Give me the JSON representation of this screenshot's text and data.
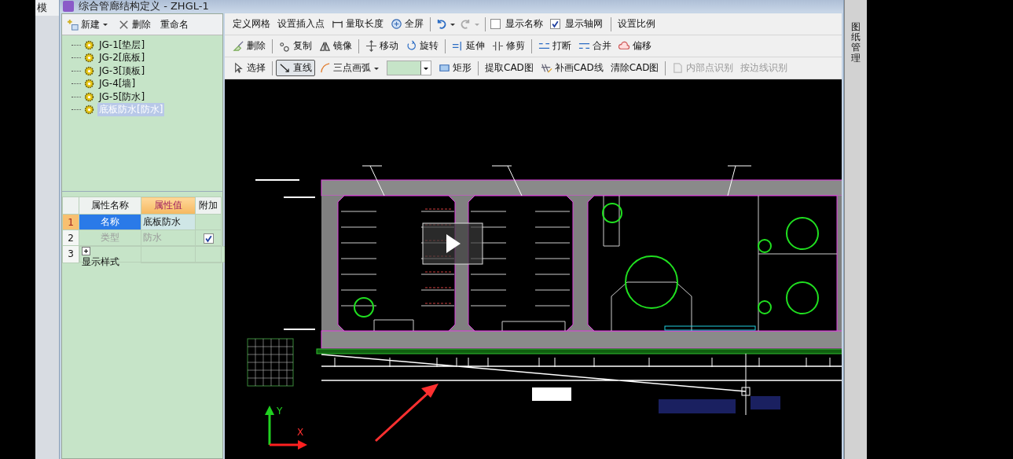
{
  "background_app": {
    "label": "模"
  },
  "window": {
    "title": "综合管廊结构定义 - ZHGL-1"
  },
  "tree_toolbar": [
    {
      "label": "新建",
      "dropdown": true
    },
    {
      "label": "删除",
      "dropdown": false
    },
    {
      "label": "重命名",
      "dropdown": false
    }
  ],
  "tree": {
    "items": [
      {
        "label": "JG-1[垫层]",
        "selected": false
      },
      {
        "label": "JG-2[底板]",
        "selected": false
      },
      {
        "label": "JG-3[顶板]",
        "selected": false
      },
      {
        "label": "JG-4[墙]",
        "selected": false
      },
      {
        "label": "JG-5[防水]",
        "selected": false
      },
      {
        "label": "底板防水[防水]",
        "selected": true
      }
    ]
  },
  "properties": {
    "columns": [
      {
        "label": "属性名称",
        "selected": false
      },
      {
        "label": "属性值",
        "selected": true
      },
      {
        "label": "附加",
        "selected": false
      }
    ],
    "rows": [
      {
        "number": "1",
        "name": "名称",
        "value": "底板防水",
        "selected": true,
        "disabled": false
      },
      {
        "number": "2",
        "name": "类型",
        "value": "防水",
        "selected": false,
        "disabled": true,
        "extra_checked": true
      },
      {
        "number": "3",
        "name": "显示样式",
        "selected": false,
        "disabled": false,
        "expanded": false
      }
    ]
  },
  "toolbar_rows": [
    [
      {
        "kind": "button",
        "label": "定义网格"
      },
      {
        "kind": "button",
        "label": "设置插入点"
      },
      {
        "kind": "button",
        "label": "量取长度"
      },
      {
        "kind": "button",
        "label": "全屏"
      },
      {
        "kind": "separator"
      },
      {
        "kind": "icon-button",
        "dropdown": true,
        "disabled": false
      },
      {
        "kind": "icon-button",
        "dropdown": true,
        "disabled": true
      },
      {
        "kind": "separator"
      },
      {
        "kind": "checkbox",
        "label": "显示名称",
        "checked": false
      },
      {
        "kind": "checkbox",
        "label": "显示轴网",
        "checked": true
      },
      {
        "kind": "separator"
      },
      {
        "kind": "button",
        "label": "设置比例"
      }
    ],
    [
      {
        "kind": "button",
        "label": "删除"
      },
      {
        "kind": "separator"
      },
      {
        "kind": "button",
        "label": "复制"
      },
      {
        "kind": "button",
        "label": "镜像"
      },
      {
        "kind": "separator"
      },
      {
        "kind": "button",
        "label": "移动"
      },
      {
        "kind": "button",
        "label": "旋转"
      },
      {
        "kind": "separator"
      },
      {
        "kind": "button",
        "label": "延伸"
      },
      {
        "kind": "button",
        "label": "修剪"
      },
      {
        "kind": "separator"
      },
      {
        "kind": "button",
        "label": "打断"
      },
      {
        "kind": "button",
        "label": "合并"
      },
      {
        "kind": "button",
        "label": "偏移"
      }
    ],
    [
      {
        "kind": "button",
        "label": "选择",
        "selected": false
      },
      {
        "kind": "separator"
      },
      {
        "kind": "button",
        "label": "直线",
        "selected": true
      },
      {
        "kind": "button",
        "label": "三点画弧",
        "selected": false,
        "dropdown": true
      },
      {
        "kind": "color-dropdown"
      },
      {
        "kind": "button",
        "label": "矩形",
        "selected": false
      },
      {
        "kind": "separator"
      },
      {
        "kind": "button",
        "label": "提取CAD图"
      },
      {
        "kind": "button",
        "label": "补画CAD线"
      },
      {
        "kind": "button",
        "label": "清除CAD图"
      },
      {
        "kind": "separator"
      },
      {
        "kind": "button",
        "label": "内部点识别",
        "disabled": true
      },
      {
        "kind": "button",
        "label": "按边线识别",
        "disabled": true
      }
    ]
  ],
  "side_tab": {
    "label": "图纸管理"
  },
  "canvas": {
    "y_label": "Y",
    "x_label": "X"
  }
}
